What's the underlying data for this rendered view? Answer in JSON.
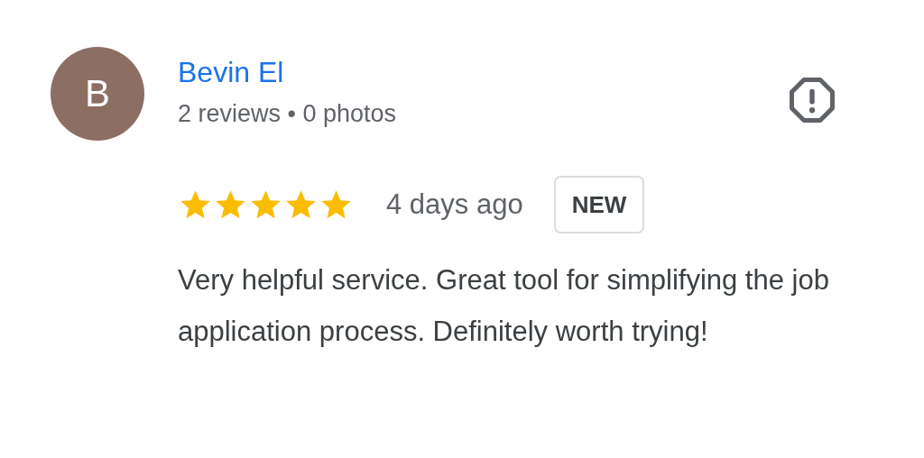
{
  "reviewer": {
    "initial": "B",
    "name": "Bevin El",
    "meta": "2 reviews • 0 photos"
  },
  "review": {
    "stars": 5,
    "time": "4 days ago",
    "badge": "NEW",
    "text": "Very helpful service. Great tool for simplifying the job application process. Definitely worth trying!"
  }
}
